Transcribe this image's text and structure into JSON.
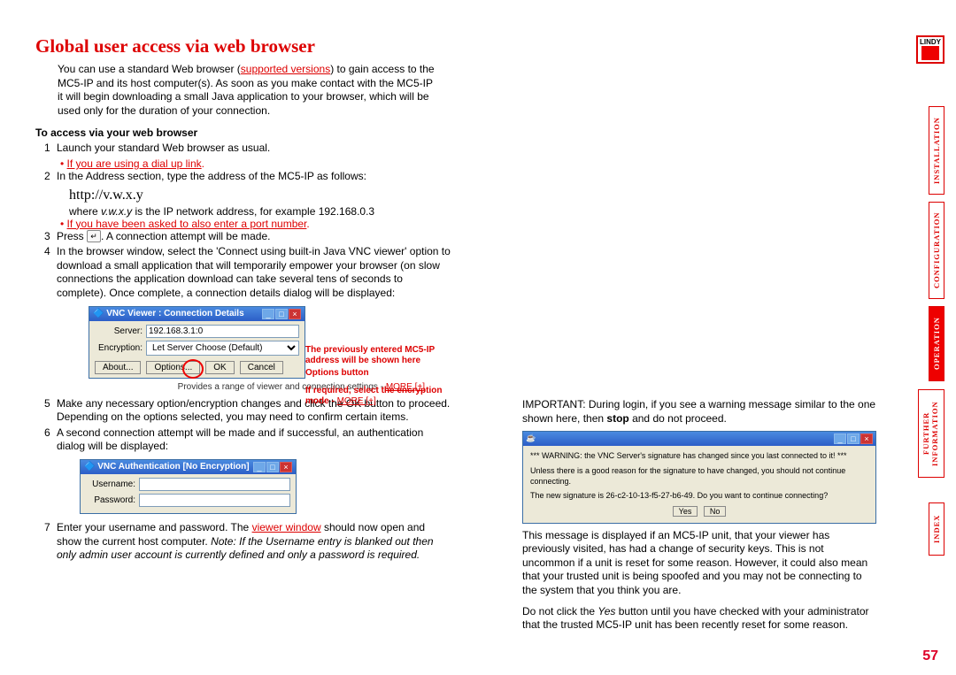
{
  "title": "Global user access via web browser",
  "intro": {
    "p1a": "You can use a standard Web browser (",
    "p1_link": "supported versions",
    "p1b": ") to gain access to the MC5-IP and its host computer(s). As soon as you make contact with the MC5-IP it will begin downloading a small Java application to your browser, which will be used only for the duration of your connection."
  },
  "subhead": "To access via your web browser",
  "steps": {
    "s1": "Launch your standard Web browser as usual.",
    "s1_bullet": "If you are using a dial up link",
    "s2": "In the Address section, type the address of the MC5-IP as follows:",
    "addr": "http://v.w.x.y",
    "s2_where_a": "where ",
    "s2_where_i": "v.w.x.y",
    "s2_where_b": " is the IP network address, for example 192.168.0.3",
    "s2_bullet": "If you have been asked to also enter a port number",
    "s3a": "Press ",
    "s3b": ". A connection attempt will be made.",
    "s4": "In the browser window, select the 'Connect using built-in Java VNC viewer' option to download a small application that will temporarily empower your browser (on slow connections the application download can take several tens of seconds to complete). Once complete, a connection details dialog will be displayed:",
    "s5": "Make any necessary option/encryption changes and click the OK button to proceed. Depending on the options selected, you may need to confirm certain items.",
    "s6": "A second connection attempt will be made and if successful, an authentication dialog will be displayed:",
    "s7a": "Enter your username and password. The ",
    "s7_link": "viewer window",
    "s7b": " should now open and show the current host computer. ",
    "s7_note": "Note: If the Username entry is blanked out then only admin user account is currently defined and only a password is required."
  },
  "vnc1": {
    "title": "VNC Viewer : Connection Details",
    "server_lbl": "Server:",
    "server_val": "192.168.3.1:0",
    "enc_lbl": "Encryption:",
    "enc_val": "Let Server Choose (Default)",
    "btn_about": "About...",
    "btn_options": "Options...",
    "btn_ok": "OK",
    "btn_cancel": "Cancel"
  },
  "annot": {
    "l1": "The previously entered MC5-IP address will be shown here",
    "l2": "Options button",
    "l3": "If required, select the encryption mode - ",
    "more": "MORE [+]"
  },
  "provides_a": "Provides a range of viewer and connection settings - ",
  "provides_more": "MORE [+]",
  "auth": {
    "title": "VNC Authentication [No Encryption]",
    "user_lbl": "Username:",
    "pass_lbl": "Password:"
  },
  "right": {
    "important_a": "IMPORTANT: During login, if you see a warning message similar to the one shown here, then ",
    "important_b": "stop",
    "important_c": " and do not proceed.",
    "warn1": "*** WARNING: the VNC Server's signature has changed since you last connected to it! ***",
    "warn2": "Unless there is a good reason for the signature to have changed, you should not continue connecting.",
    "warn3": "The new signature is 26-c2-10-13-f5-27-b6-49. Do you want to continue connecting?",
    "yes": "Yes",
    "no": "No",
    "p2": "This message is displayed if an MC5-IP unit, that your viewer has previously visited, has had a change of security keys. This is not uncommon if a unit is reset for some reason. However, it could also mean that your trusted unit is being spoofed and you may not be connecting to the system that you think you are.",
    "p3a": "Do not click the ",
    "p3i": "Yes",
    "p3b": " button until you have checked with your administrator that the trusted MC5-IP unit has been recently reset for some reason."
  },
  "nav": {
    "installation": "INSTALLATION",
    "configuration": "CONFIGURATION",
    "operation": "OPERATION",
    "further": "FURTHER INFORMATION",
    "index": "INDEX"
  },
  "logo": "LINDY",
  "pagenum": "57"
}
